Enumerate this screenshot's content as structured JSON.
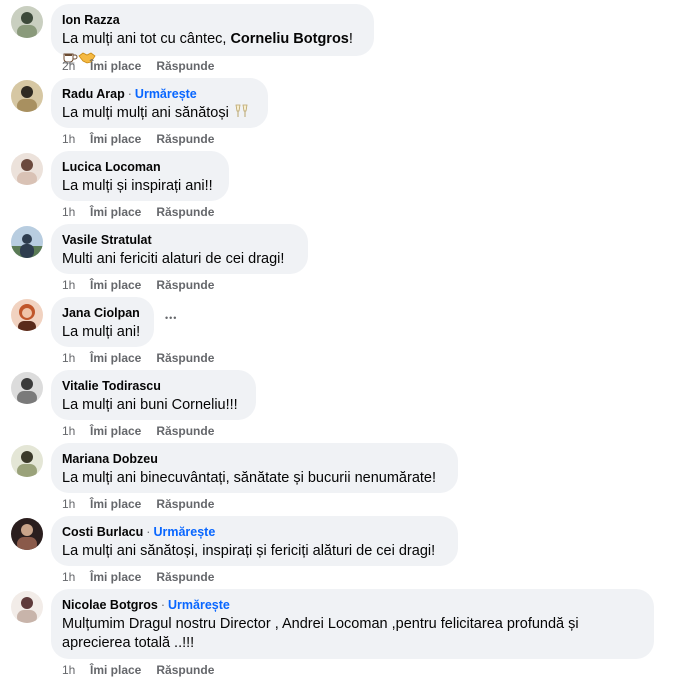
{
  "comments": [
    {
      "author": "Ion Razza",
      "follow": "",
      "text_before": "La mulți ani tot cu cântec, ",
      "text_bold": "Corneliu Botgros",
      "text_after": "!",
      "emojis": [
        "coffee-emoji",
        "handshake-emoji"
      ],
      "time": "2h",
      "like": "Îmi place",
      "reply": "Răspunde",
      "avatar_colors": [
        "#8a9a7b",
        "#3d4a3a"
      ]
    },
    {
      "author": "Radu Arap",
      "follow": "Urmărește",
      "text": "La mulți mulți ani sănătoși",
      "emojis": [
        "champagne-emoji"
      ],
      "time": "1h",
      "like": "Îmi place",
      "reply": "Răspunde",
      "avatar_colors": [
        "#a89060",
        "#2f2a22"
      ]
    },
    {
      "author": "Lucica Locoman",
      "follow": "",
      "text": "La mulți și inspirați ani!!",
      "time": "1h",
      "like": "Îmi place",
      "reply": "Răspunde",
      "avatar_colors": [
        "#d9c2b5",
        "#6b4a3e"
      ]
    },
    {
      "author": "Vasile Stratulat",
      "follow": "",
      "text": "Multi ani fericiti alaturi de cei dragi!",
      "time": "1h",
      "like": "Îmi place",
      "reply": "Răspunde",
      "avatar_colors": [
        "#7fa3c7",
        "#2e3d4f"
      ]
    },
    {
      "author": "Jana Ciolpan",
      "follow": "",
      "text": "La mulți ani!",
      "more": "•••",
      "time": "1h",
      "like": "Îmi place",
      "reply": "Răspunde",
      "avatar_colors": [
        "#d88a5a",
        "#5a2a1a"
      ]
    },
    {
      "author": "Vitalie Todirascu",
      "follow": "",
      "text": "La mulți ani buni Corneliu!!!",
      "time": "1h",
      "like": "Îmi place",
      "reply": "Răspunde",
      "avatar_colors": [
        "#bdbdbd",
        "#3a3a3a"
      ]
    },
    {
      "author": "Mariana Dobzeu",
      "follow": "",
      "text": "La mulți ani binecuvântați, sănătate și bucurii nenumărate!",
      "time": "1h",
      "like": "Îmi place",
      "reply": "Răspunde",
      "avatar_colors": [
        "#9aa27a",
        "#3b3a2a"
      ]
    },
    {
      "author": "Costi Burlacu",
      "follow": "Urmărește",
      "text": "La mulți ani sănătoși, inspirați și fericiți alături de cei dragi!",
      "time": "1h",
      "like": "Îmi place",
      "reply": "Răspunde",
      "avatar_colors": [
        "#8a5a4a",
        "#1e1a1a"
      ]
    },
    {
      "author": "Nicolae Botgros",
      "follow": "Urmărește",
      "text_line1": "Mulțumim Dragul nostru Director , Andrei Locoman ,pentru felicitarea profundă și",
      "text_line2": "aprecierea totală ..!!!",
      "time": "1h",
      "like": "Îmi place",
      "reply": "Răspunde",
      "avatar_colors": [
        "#e0d4cc",
        "#5e3a3a"
      ]
    }
  ],
  "colors": {
    "bubble": "#f0f2f5",
    "meta": "#65676b",
    "follow": "#0866ff"
  }
}
